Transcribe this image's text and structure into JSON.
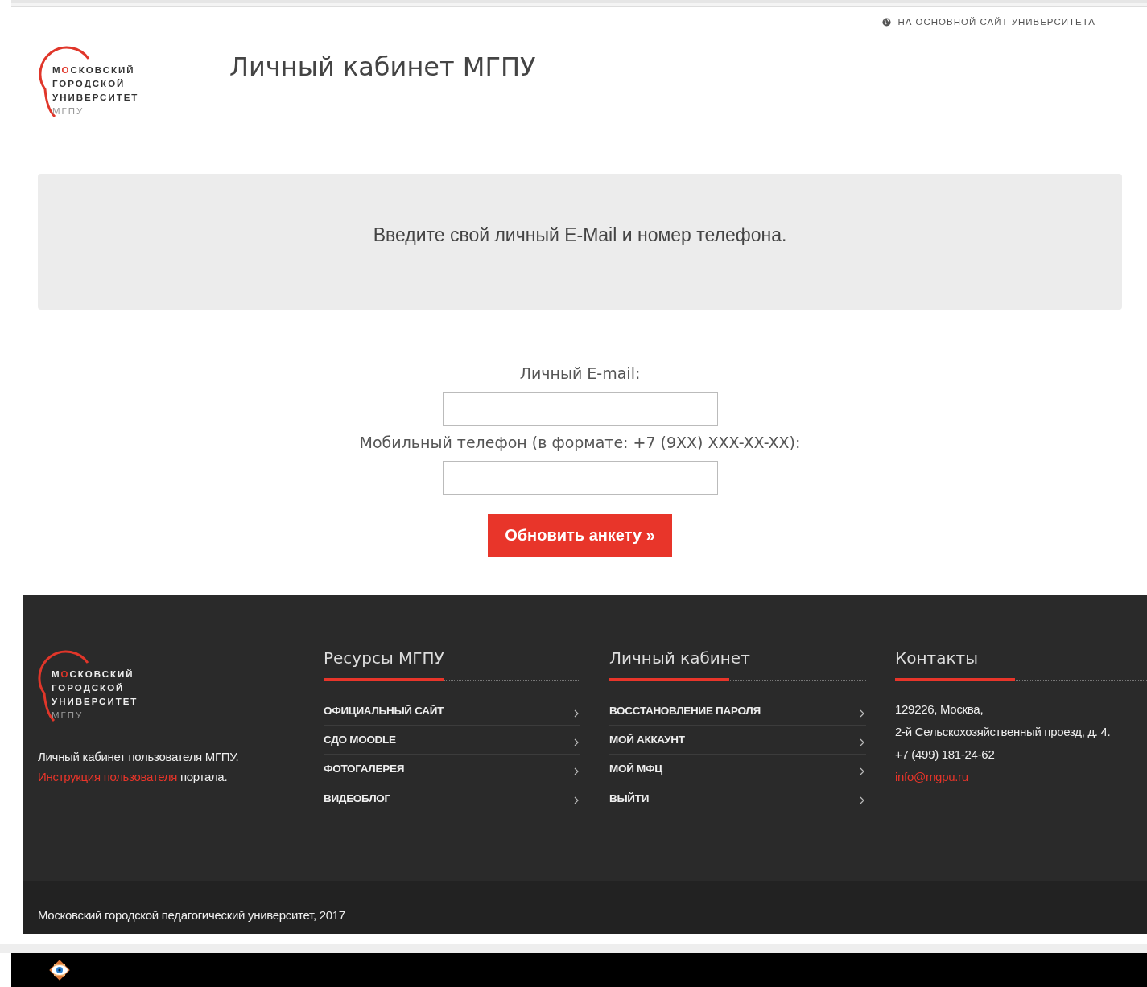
{
  "top_link": {
    "label": "НА ОСНОВНОЙ САЙТ УНИВЕРСИТЕТА"
  },
  "logo": {
    "line1_start": "М",
    "line1_accent": "О",
    "line1_end": "СКОВСКИЙ",
    "line2": "ГОРОДСКОЙ",
    "line3": "УНИВЕРСИТЕТ",
    "line4": "МГПУ"
  },
  "header": {
    "title": "Личный кабинет МГПУ"
  },
  "notice": {
    "text": "Введите свой личный E-Mail и номер телефона."
  },
  "form": {
    "fields": [
      {
        "label": "Личный E-mail:"
      },
      {
        "label": "Мобильный телефон (в формате: +7 (9XX) XXX-XX-XX):"
      }
    ],
    "submit": "Обновить анкету »"
  },
  "footer": {
    "logo": {
      "line1_start": "М",
      "line1_accent": "О",
      "line1_end": "СКОВСКИЙ",
      "line2": "ГОРОДСКОЙ",
      "line3": "УНИВЕРСИТЕТ",
      "line4": "МГПУ"
    },
    "about": "Личный кабинет пользователя МГПУ.",
    "link": "Инструкция пользователя",
    "link_after": "портала.",
    "columns": [
      {
        "title": "Ресурсы МГПУ",
        "links": [
          "ОФИЦИАЛЬНЫЙ САЙТ",
          "СДО MOODLE",
          "ФОТОГАЛЕРЕЯ",
          "ВИДЕОБЛОГ"
        ]
      },
      {
        "title": "Личный кабинет",
        "links": [
          "ВОССТАНОВЛЕНИЕ ПАРОЛЯ",
          "МОЙ АККАУНТ",
          "МОЙ МФЦ",
          "ВЫЙТИ"
        ]
      }
    ],
    "contacts": {
      "title": "Контакты",
      "lines": [
        "129226, Москва,",
        "2-й Сельскохозяйственный проезд, д. 4.",
        "+7 (499) 181-24-62"
      ],
      "email": "info@mgpu.ru"
    },
    "copyright": "Московский городской педагогический университет, 2017"
  }
}
